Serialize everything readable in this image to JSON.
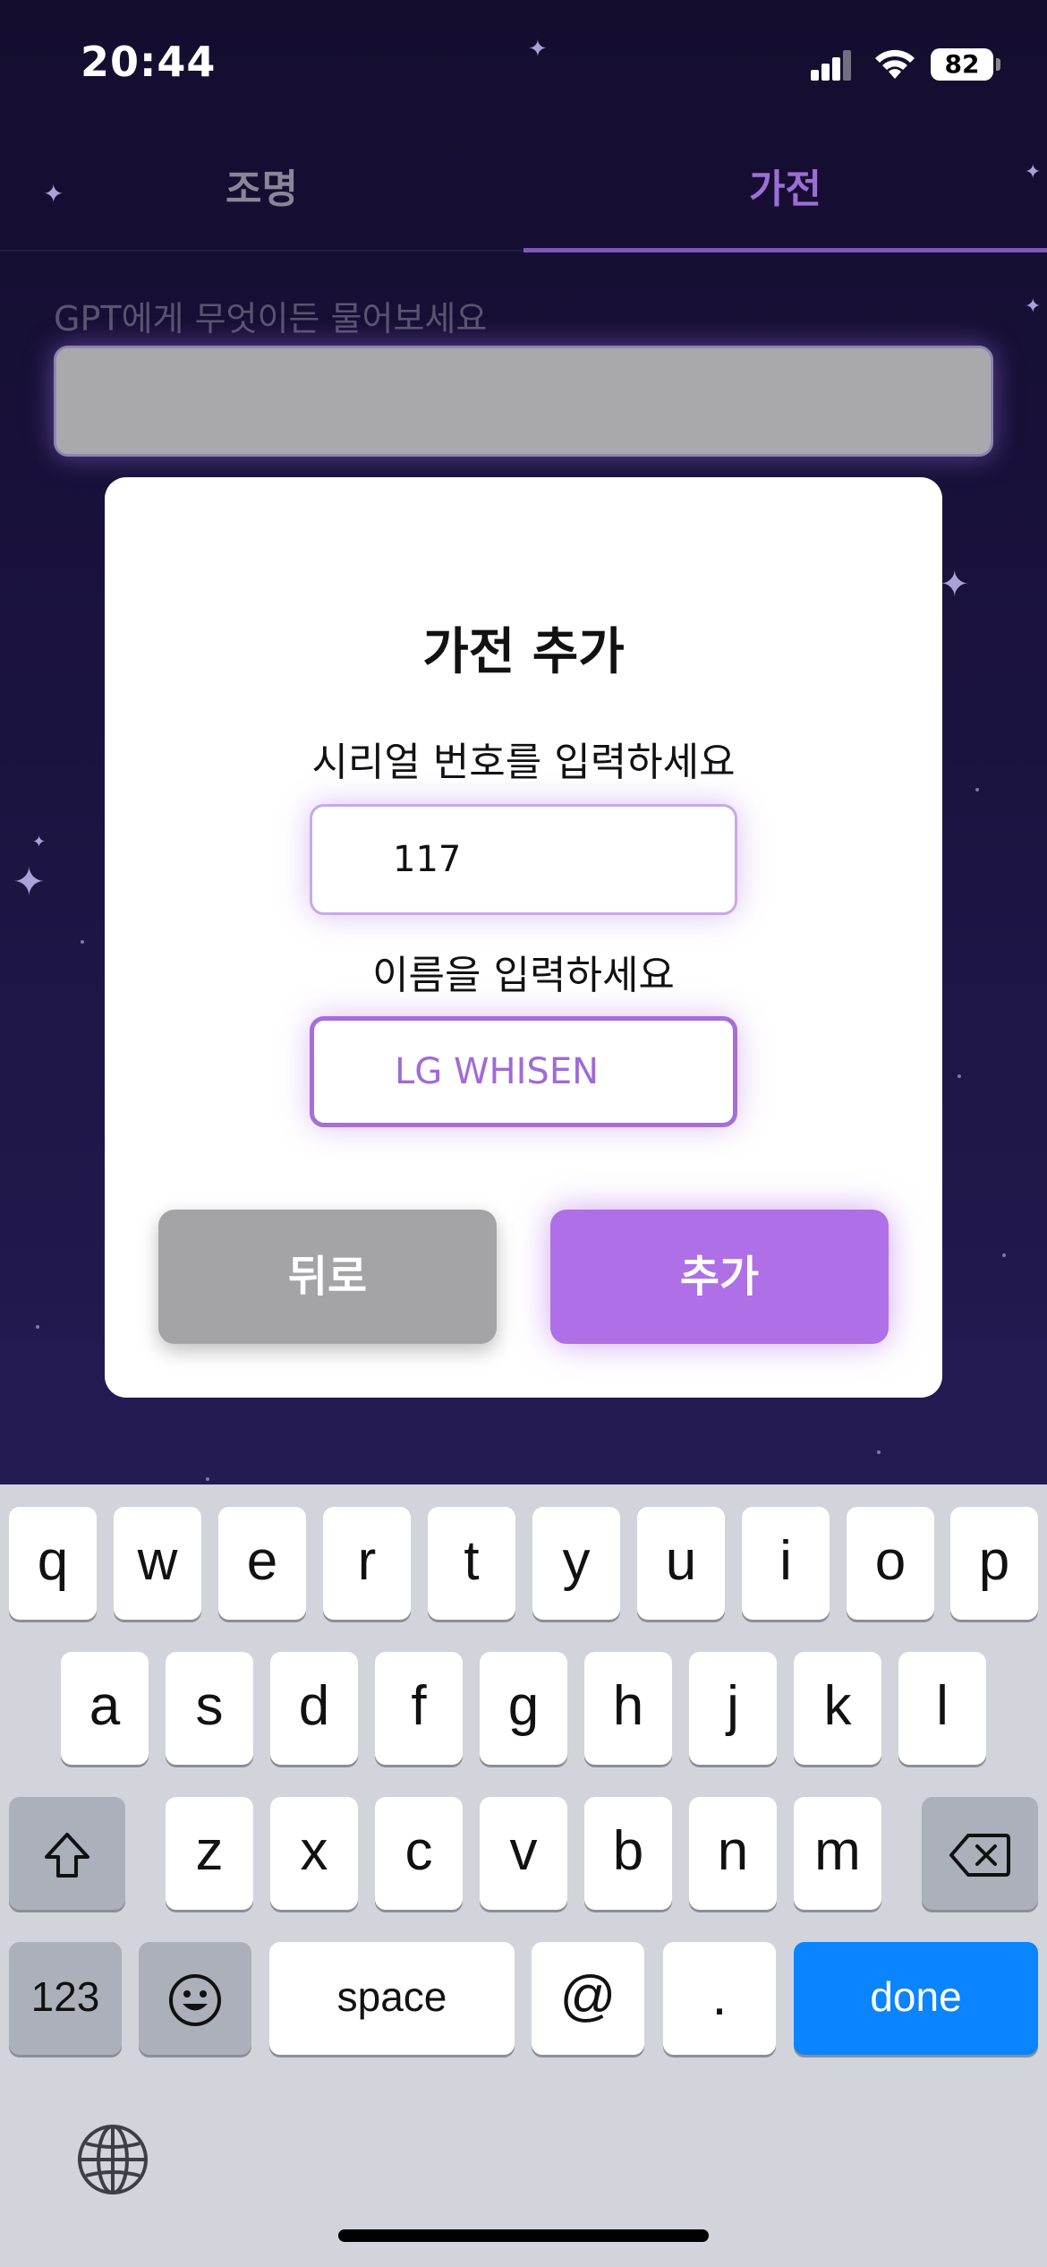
{
  "status_bar": {
    "time": "20:44",
    "battery": "82"
  },
  "tabs": [
    {
      "label": "조명",
      "active": false
    },
    {
      "label": "가전",
      "active": true
    }
  ],
  "gpt": {
    "label": "GPT에게 무엇이든 물어보세요",
    "value": ""
  },
  "dialog": {
    "title": "가전 추가",
    "serial_label": "시리얼 번호를 입력하세요",
    "serial_value": "117",
    "name_label": "이름을 입력하세요",
    "name_value": "LG WHISEN",
    "back_label": "뒤로",
    "add_label": "추가"
  },
  "keyboard": {
    "row1": [
      "q",
      "w",
      "e",
      "r",
      "t",
      "y",
      "u",
      "i",
      "o",
      "p"
    ],
    "row2": [
      "a",
      "s",
      "d",
      "f",
      "g",
      "h",
      "j",
      "k",
      "l"
    ],
    "row3": [
      "z",
      "x",
      "c",
      "v",
      "b",
      "n",
      "m"
    ],
    "numbers_label": "123",
    "space_label": "space",
    "at_label": "@",
    "period_label": ".",
    "done_label": "done",
    "accent_color": "#0a84ff"
  },
  "colors": {
    "accent": "#af6fe6",
    "tab_active": "#9c6ed6",
    "back_button": "#a4a4a6"
  }
}
